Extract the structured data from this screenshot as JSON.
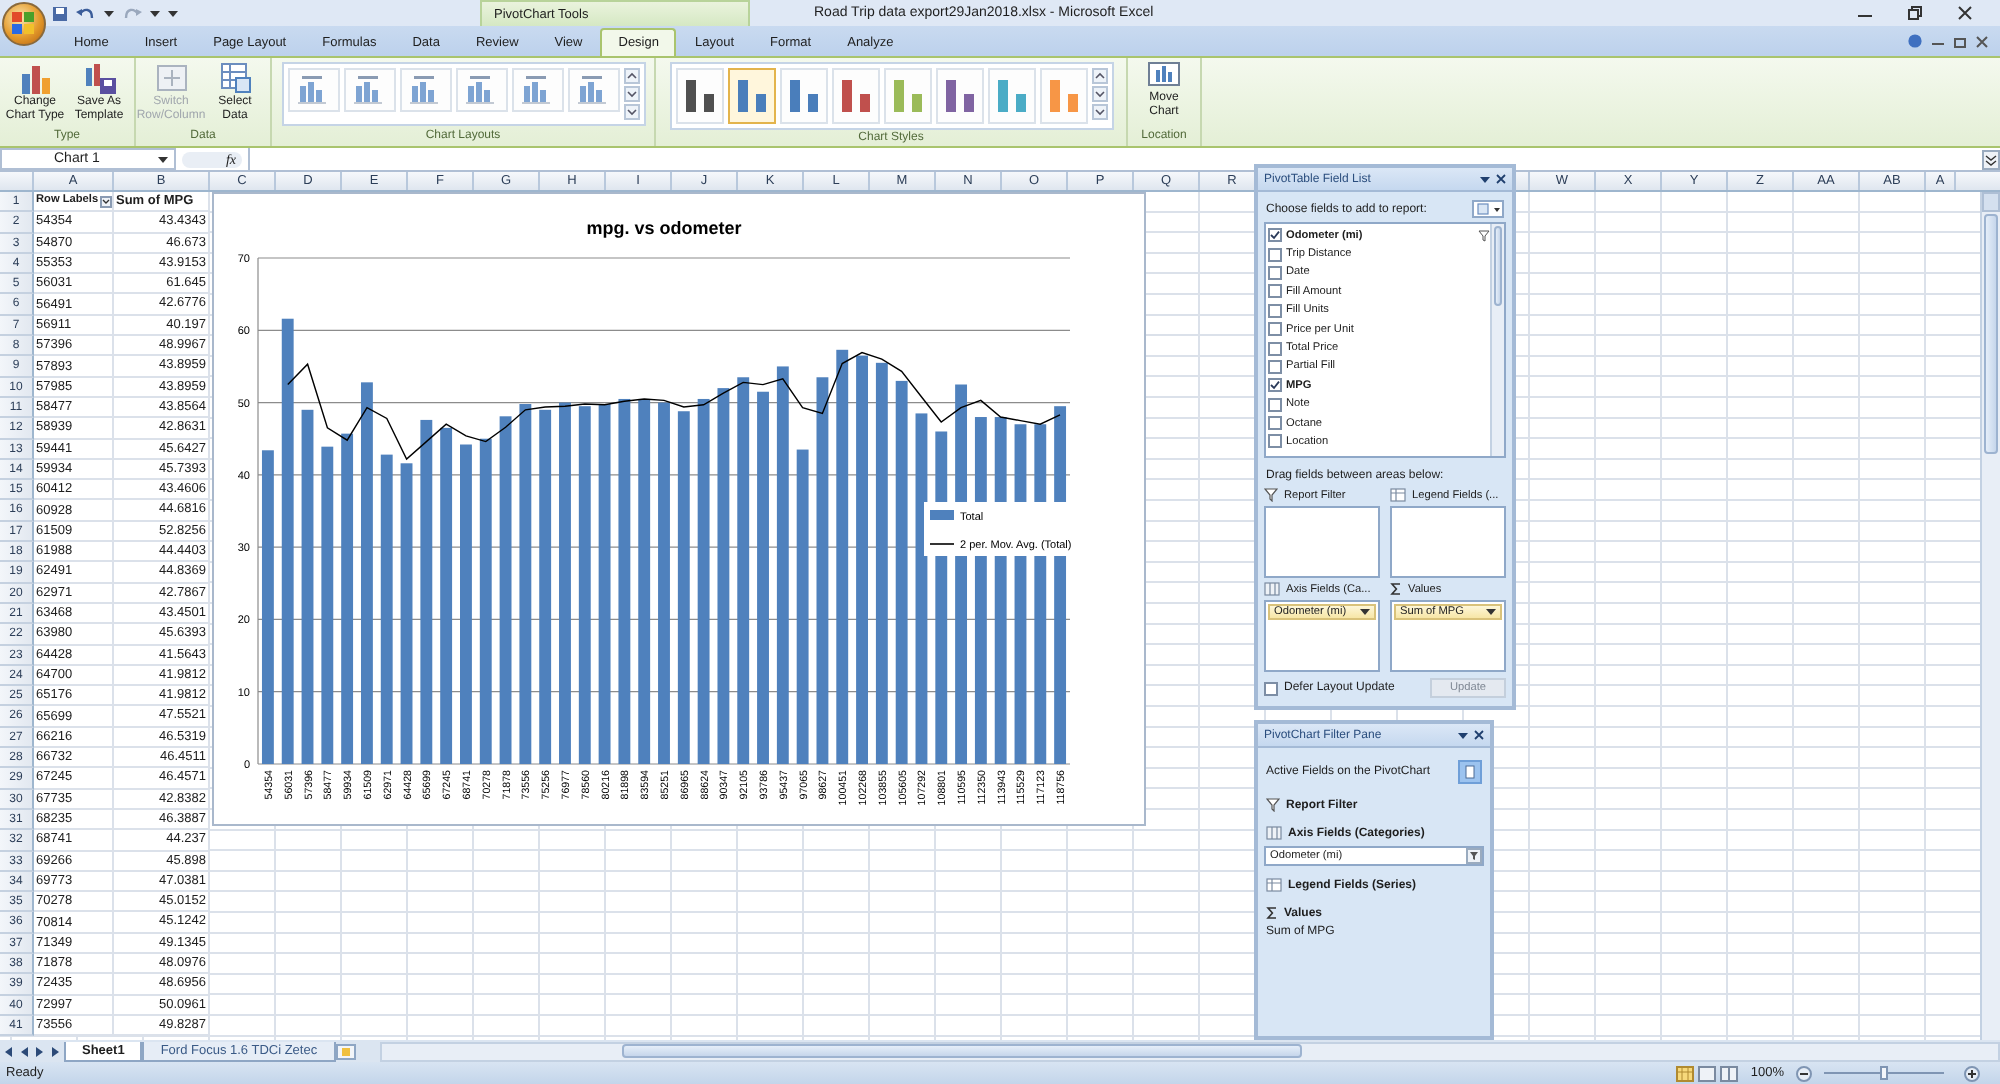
{
  "window": {
    "title": "Road Trip data export29Jan2018.xlsx - Microsoft Excel"
  },
  "contextual_group": "PivotChart Tools",
  "tabs": [
    {
      "label": "Home",
      "selected": false
    },
    {
      "label": "Insert",
      "selected": false
    },
    {
      "label": "Page Layout",
      "selected": false
    },
    {
      "label": "Formulas",
      "selected": false
    },
    {
      "label": "Data",
      "selected": false
    },
    {
      "label": "Review",
      "selected": false
    },
    {
      "label": "View",
      "selected": false
    },
    {
      "label": "Design",
      "selected": true
    },
    {
      "label": "Layout",
      "selected": false
    },
    {
      "label": "Format",
      "selected": false
    },
    {
      "label": "Analyze",
      "selected": false
    }
  ],
  "ribbon": {
    "groups": [
      {
        "kind": "buttons",
        "label": "Type",
        "buttons": [
          {
            "kind": "chart-type",
            "label": "Change Chart Type",
            "disabled": false
          },
          {
            "kind": "template",
            "label": "Save As Template",
            "disabled": false
          }
        ]
      },
      {
        "kind": "buttons",
        "label": "Data",
        "buttons": [
          {
            "kind": "switch",
            "label": "Switch Row/Column",
            "disabled": true
          },
          {
            "kind": "select",
            "label": "Select Data",
            "disabled": false
          }
        ]
      },
      {
        "kind": "layouts",
        "label": "Chart Layouts"
      },
      {
        "kind": "styles",
        "label": "Chart Styles",
        "styles": [
          {
            "color": "#505050",
            "selected": false
          },
          {
            "color": "#4a7ebb",
            "selected": true
          },
          {
            "color": "#4a7ebb",
            "selected": false
          },
          {
            "color": "#c0504d",
            "selected": false
          },
          {
            "color": "#9bbb59",
            "selected": false
          },
          {
            "color": "#8064a2",
            "selected": false
          },
          {
            "color": "#4bacc6",
            "selected": false
          },
          {
            "color": "#f79646",
            "selected": false
          }
        ]
      },
      {
        "kind": "buttons",
        "label": "Location",
        "buttons": [
          {
            "kind": "move",
            "label": "Move Chart",
            "disabled": false
          }
        ]
      }
    ]
  },
  "formula_bar": {
    "name_box": "Chart 1",
    "function_label": "fx"
  },
  "sheet": {
    "columns_left": [
      "A",
      "B",
      "C",
      "D",
      "E",
      "F",
      "G",
      "H",
      "I",
      "J",
      "K",
      "L",
      "M",
      "N",
      "O",
      "P",
      "Q",
      "R"
    ],
    "columns_right": [
      "W",
      "X",
      "Y",
      "Z",
      "AA",
      "AB",
      "A"
    ],
    "rows": [
      {
        "number": "1",
        "kind": "header",
        "label": "Row Labels",
        "value": "Sum of MPG"
      },
      {
        "number": "2",
        "kind": "data",
        "label": "54354",
        "value": "43.4343"
      },
      {
        "number": "3",
        "kind": "data",
        "label": "54870",
        "value": "46.673"
      },
      {
        "number": "4",
        "kind": "data",
        "label": "55353",
        "value": "43.9153"
      },
      {
        "number": "5",
        "kind": "data",
        "label": "56031",
        "value": "61.645"
      },
      {
        "number": "6",
        "kind": "data",
        "label": "56491",
        "value": "42.6776"
      },
      {
        "number": "7",
        "kind": "data",
        "label": "56911",
        "value": "40.197"
      },
      {
        "number": "8",
        "kind": "data",
        "label": "57396",
        "value": "48.9967"
      },
      {
        "number": "9",
        "kind": "data",
        "label": "57893",
        "value": "43.8959"
      },
      {
        "number": "10",
        "kind": "data",
        "label": "57985",
        "value": "43.8959"
      },
      {
        "number": "11",
        "kind": "data",
        "label": "58477",
        "value": "43.8564"
      },
      {
        "number": "12",
        "kind": "data",
        "label": "58939",
        "value": "42.8631"
      },
      {
        "number": "13",
        "kind": "data",
        "label": "59441",
        "value": "45.6427"
      },
      {
        "number": "14",
        "kind": "data",
        "label": "59934",
        "value": "45.7393"
      },
      {
        "number": "15",
        "kind": "data",
        "label": "60412",
        "value": "43.4606"
      },
      {
        "number": "16",
        "kind": "data",
        "label": "60928",
        "value": "44.6816"
      },
      {
        "number": "17",
        "kind": "data",
        "label": "61509",
        "value": "52.8256"
      },
      {
        "number": "18",
        "kind": "data",
        "label": "61988",
        "value": "44.4403"
      },
      {
        "number": "19",
        "kind": "data",
        "label": "62491",
        "value": "44.8369"
      },
      {
        "number": "20",
        "kind": "data",
        "label": "62971",
        "value": "42.7867"
      },
      {
        "number": "21",
        "kind": "data",
        "label": "63468",
        "value": "43.4501"
      },
      {
        "number": "22",
        "kind": "data",
        "label": "63980",
        "value": "45.6393"
      },
      {
        "number": "23",
        "kind": "data",
        "label": "64428",
        "value": "41.5643"
      },
      {
        "number": "24",
        "kind": "data",
        "label": "64700",
        "value": "41.9812"
      },
      {
        "number": "25",
        "kind": "data",
        "label": "65176",
        "value": "41.9812"
      },
      {
        "number": "26",
        "kind": "data",
        "label": "65699",
        "value": "47.5521"
      },
      {
        "number": "27",
        "kind": "data",
        "label": "66216",
        "value": "46.5319"
      },
      {
        "number": "28",
        "kind": "data",
        "label": "66732",
        "value": "46.4511"
      },
      {
        "number": "29",
        "kind": "data",
        "label": "67245",
        "value": "46.4571"
      },
      {
        "number": "30",
        "kind": "data",
        "label": "67735",
        "value": "42.8382"
      },
      {
        "number": "31",
        "kind": "data",
        "label": "68235",
        "value": "46.3887"
      },
      {
        "number": "32",
        "kind": "data",
        "label": "68741",
        "value": "44.237"
      },
      {
        "number": "33",
        "kind": "data",
        "label": "69266",
        "value": "45.898"
      },
      {
        "number": "34",
        "kind": "data",
        "label": "69773",
        "value": "47.0381"
      },
      {
        "number": "35",
        "kind": "data",
        "label": "70278",
        "value": "45.0152"
      },
      {
        "number": "36",
        "kind": "data",
        "label": "70814",
        "value": "45.1242"
      },
      {
        "number": "37",
        "kind": "data",
        "label": "71349",
        "value": "49.1345"
      },
      {
        "number": "38",
        "kind": "data",
        "label": "71878",
        "value": "48.0976"
      },
      {
        "number": "39",
        "kind": "data",
        "label": "72435",
        "value": "48.6956"
      },
      {
        "number": "40",
        "kind": "data",
        "label": "72997",
        "value": "50.0961"
      },
      {
        "number": "41",
        "kind": "data",
        "label": "73556",
        "value": "49.8287"
      }
    ]
  },
  "chart": {
    "chart_data": {
      "type": "bar",
      "title": "mpg. vs odometer",
      "categories": [
        "54354",
        "56031",
        "57396",
        "58477",
        "59934",
        "61509",
        "62971",
        "64428",
        "65699",
        "67245",
        "68741",
        "70278",
        "71878",
        "73556",
        "75256",
        "76977",
        "78560",
        "80216",
        "81898",
        "83594",
        "85251",
        "86965",
        "88624",
        "90347",
        "92105",
        "93786",
        "95437",
        "97065",
        "98627",
        "100451",
        "102268",
        "103855",
        "105605",
        "107292",
        "108801",
        "110595",
        "112350",
        "113943",
        "115529",
        "117123",
        "118756"
      ],
      "series": [
        {
          "name": "Total",
          "color": "#4f81bd",
          "values": [
            43.4,
            61.6,
            49,
            43.9,
            45.7,
            52.8,
            42.8,
            41.6,
            47.6,
            46.5,
            44.2,
            45,
            48.1,
            49.8,
            49,
            50,
            49.5,
            49.8,
            50.5,
            50.5,
            50,
            48.8,
            50.5,
            52,
            53.5,
            51.5,
            55,
            43.5,
            53.5,
            57.3,
            56.5,
            55.5,
            53,
            48.5,
            46,
            52.5,
            48,
            48,
            47,
            47,
            49.5
          ]
        },
        {
          "name": "2 per. Mov. Avg. (Total)",
          "type": "line",
          "color": "#000000",
          "values": [
            null,
            52.5,
            55.3,
            46.5,
            44.8,
            49.3,
            47.8,
            42.2,
            44.6,
            47,
            45.4,
            44.6,
            46.6,
            49,
            49.4,
            49.5,
            49.8,
            49.7,
            50.2,
            50.5,
            50.3,
            49.4,
            49.7,
            51.3,
            52.8,
            52.5,
            53.3,
            49.3,
            48.5,
            55.4,
            56.9,
            56,
            54.3,
            50.8,
            47.3,
            49.3,
            50.3,
            48,
            47.5,
            47,
            48.3
          ]
        }
      ],
      "ylim": [
        0,
        70
      ],
      "yticks": [
        0,
        10,
        20,
        30,
        40,
        50,
        60,
        70
      ],
      "grid": true,
      "legend": "right"
    }
  },
  "field_list": {
    "title": "PivotTable Field List",
    "prompt": "Choose fields to add to report:",
    "fields": [
      {
        "label": "Odometer (mi)",
        "checked": true
      },
      {
        "label": "Trip Distance",
        "checked": false
      },
      {
        "label": "Date",
        "checked": false
      },
      {
        "label": "Fill Amount",
        "checked": false
      },
      {
        "label": "Fill Units",
        "checked": false
      },
      {
        "label": "Price per Unit",
        "checked": false
      },
      {
        "label": "Total Price",
        "checked": false
      },
      {
        "label": "Partial Fill",
        "checked": false
      },
      {
        "label": "MPG",
        "checked": true
      },
      {
        "label": "Note",
        "checked": false
      },
      {
        "label": "Octane",
        "checked": false
      },
      {
        "label": "Location",
        "checked": false
      }
    ],
    "areas_prompt": "Drag fields between areas below:",
    "areas": [
      {
        "kind": "filter",
        "label": "Report Filter"
      },
      {
        "kind": "legend",
        "label": "Legend Fields (..."
      },
      {
        "kind": "axis",
        "label": "Axis Fields (Ca...",
        "items": [
          "Odometer (mi)"
        ]
      },
      {
        "kind": "values",
        "label": "Values",
        "items": [
          "Sum of MPG"
        ]
      }
    ],
    "defer": {
      "label": "Defer Layout Update",
      "checked": false
    },
    "update_button": {
      "label": "Update",
      "disabled": true
    }
  },
  "filter_pane": {
    "title": "PivotChart Filter Pane",
    "subtitle": "Active Fields on the PivotChart",
    "sections": [
      {
        "kind": "filter",
        "label": "Report Filter"
      },
      {
        "kind": "axis",
        "label": "Axis Fields (Categories)",
        "dropdown": "Odometer (mi)"
      },
      {
        "kind": "legend",
        "label": "Legend Fields (Series)"
      },
      {
        "kind": "values",
        "label": "Values",
        "text": "Sum of MPG"
      }
    ]
  },
  "sheet_tabs": [
    {
      "label": "Sheet1",
      "selected": true
    },
    {
      "label": "Ford Focus 1.6 TDCi Zetec",
      "selected": false
    }
  ],
  "status_bar": {
    "status": "Ready",
    "zoom": "100%",
    "zoom_slider": {
      "level": 0.5
    }
  }
}
